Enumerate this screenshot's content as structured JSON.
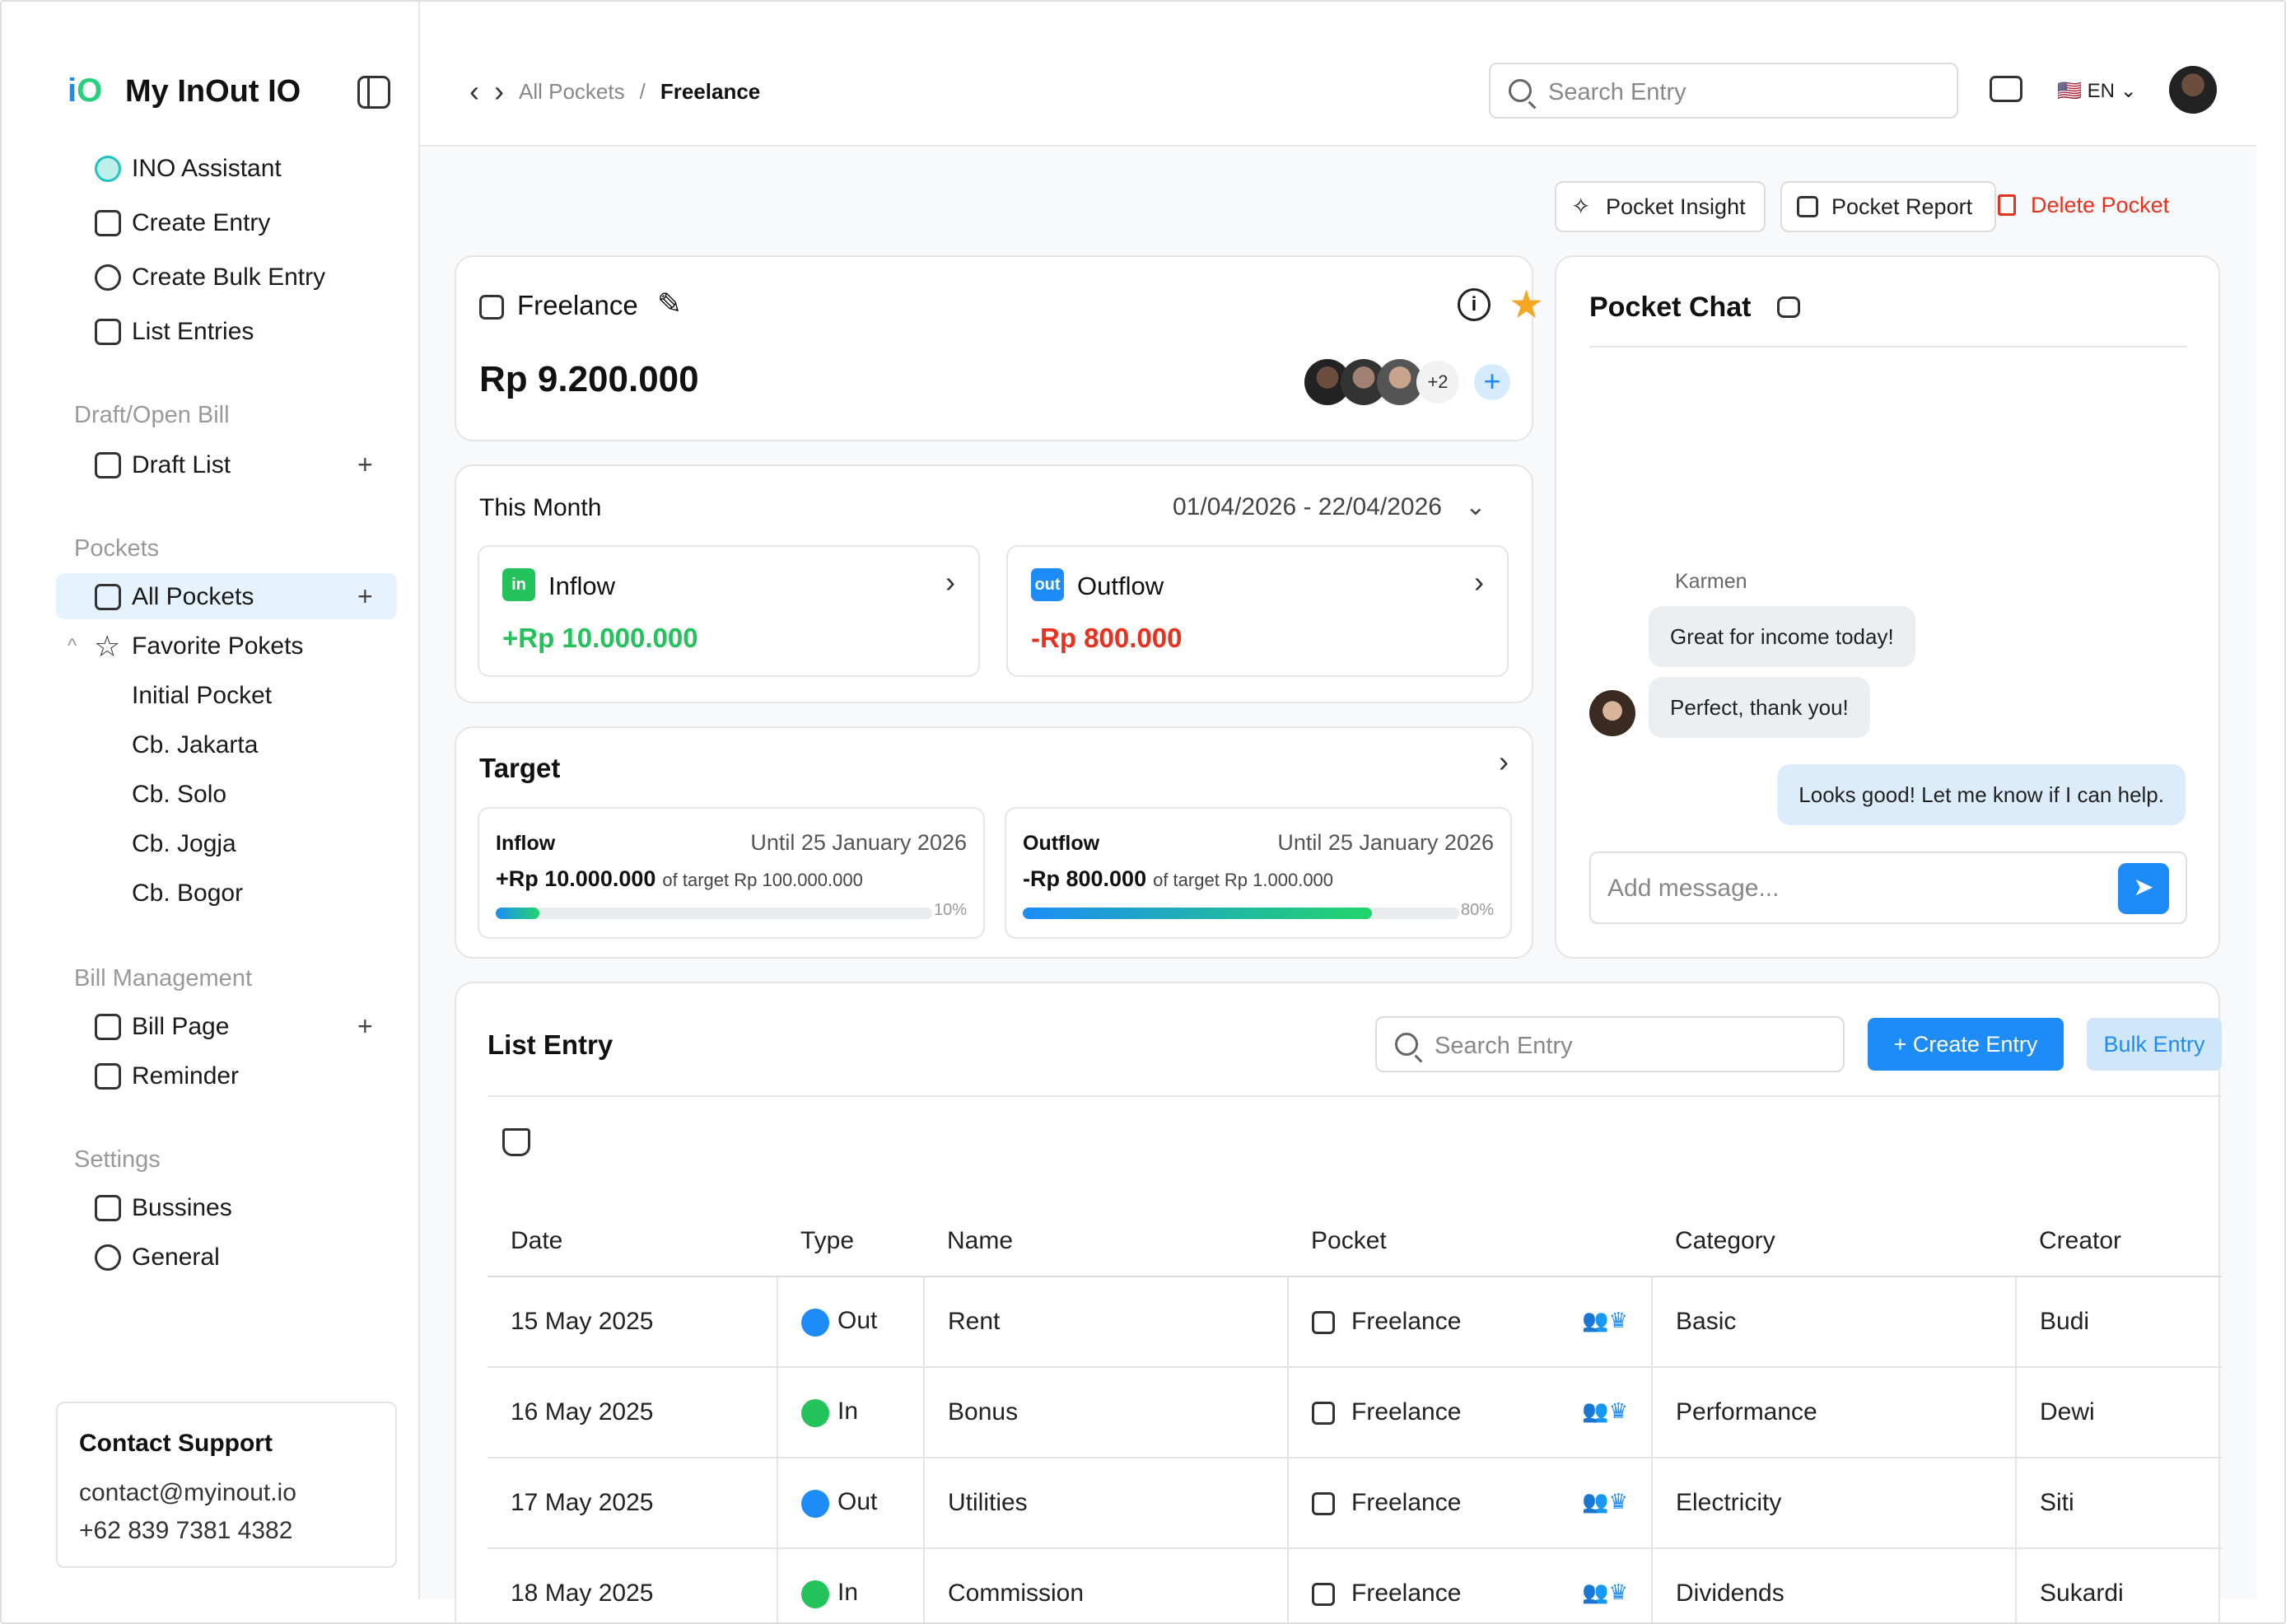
{
  "app": {
    "title": "My InOut IO",
    "logo_text": "iO"
  },
  "sidebar": {
    "assistant": "INO Assistant",
    "create_entry": "Create Entry",
    "create_bulk_entry": "Create Bulk Entry",
    "list_entries": "List Entries",
    "section_draft": "Draft/Open Bill",
    "draft_list": "Draft List",
    "section_pockets": "Pockets",
    "all_pockets": "All Pockets",
    "favorite_pockets": "Favorite Pokets",
    "favorites": [
      "Initial Pocket",
      "Cb. Jakarta",
      "Cb. Solo",
      "Cb. Jogja",
      "Cb. Bogor"
    ],
    "section_bill": "Bill Management",
    "bill_page": "Bill Page",
    "reminder": "Reminder",
    "section_settings": "Settings",
    "business": "Bussines",
    "general": "General",
    "plus": "+"
  },
  "support": {
    "title": "Contact Support",
    "email": "contact@myinout.io",
    "phone": "+62 839 7381 4382"
  },
  "header": {
    "breadcrumb": [
      "All Pockets",
      "Freelance"
    ],
    "separator": "/",
    "search_placeholder": "Search Entry",
    "language": "EN"
  },
  "actions": {
    "insight": "Pocket Insight",
    "report": "Pocket Report",
    "delete": "Delete Pocket"
  },
  "pocket": {
    "name": "Freelance",
    "amount": "Rp 9.200.000",
    "members_extra": "+2"
  },
  "month": {
    "title": "This Month",
    "range": "01/04/2026 - 22/04/2026",
    "inflow": {
      "tag": "in",
      "label": "Inflow",
      "value": "+Rp 10.000.000"
    },
    "outflow": {
      "tag": "out",
      "label": "Outflow",
      "value": "-Rp 800.000"
    }
  },
  "target": {
    "title": "Target",
    "inflow": {
      "label": "Inflow",
      "until": "Until 25 January 2026",
      "value": "+Rp 10.000.000",
      "of": "of target Rp 100.000.000",
      "pct_label": "10%",
      "progress": 0.1
    },
    "outflow": {
      "label": "Outflow",
      "until": "Until 25 January 2026",
      "value": "-Rp 800.000",
      "of": "of target Rp 1.000.000",
      "pct_label": "80%",
      "progress": 0.8
    }
  },
  "chat": {
    "title": "Pocket Chat",
    "sender": "Karmen",
    "messages": [
      "Great for income today!",
      "Perfect, thank you!",
      "Looks good! Let me know if I can help."
    ],
    "placeholder": "Add message..."
  },
  "list": {
    "title": "List Entry",
    "search_placeholder": "Search Entry",
    "create": "+ Create Entry",
    "bulk": "Bulk Entry",
    "columns": [
      "Date",
      "Type",
      "Name",
      "Pocket",
      "Category",
      "Creator"
    ],
    "rows": [
      {
        "date": "15 May 2025",
        "type": "Out",
        "name": "Rent",
        "pocket": "Freelance",
        "category": "Basic",
        "creator": "Budi"
      },
      {
        "date": "16 May 2025",
        "type": "In",
        "name": "Bonus",
        "pocket": "Freelance",
        "category": "Performance",
        "creator": "Dewi"
      },
      {
        "date": "17 May 2025",
        "type": "Out",
        "name": "Utilities",
        "pocket": "Freelance",
        "category": "Electricity",
        "creator": "Siti"
      },
      {
        "date": "18 May 2025",
        "type": "In",
        "name": "Commission",
        "pocket": "Freelance",
        "category": "Dividends",
        "creator": "Sukardi"
      }
    ]
  },
  "colors": {
    "accent": "#1d8cf8",
    "in": "#23c25a",
    "out": "#1d8cf8",
    "negative": "#e8321f",
    "star": "#f5a623"
  }
}
